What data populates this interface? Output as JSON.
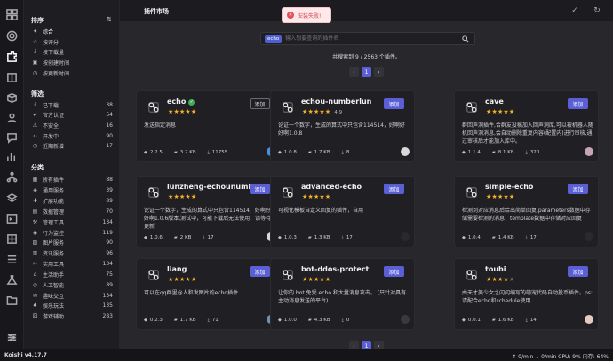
{
  "header": {
    "title": "插件市场"
  },
  "toast": {
    "text": "安装失败!"
  },
  "search": {
    "tag": "echo",
    "placeholder": "输入想要查询的插件名"
  },
  "results": {
    "text": "共搜索到 9 / 2563 个插件。"
  },
  "pagination": {
    "current": "1",
    "prev": "‹",
    "next": "›"
  },
  "sidebar": {
    "sort_title": "排序",
    "sort_items": [
      {
        "label": "综合"
      },
      {
        "label": "按评分"
      },
      {
        "label": "按下载量"
      },
      {
        "label": "按创建时间"
      },
      {
        "label": "按更新时间"
      }
    ],
    "filter_title": "筛选",
    "filter_items": [
      {
        "label": "已下载",
        "count": "38"
      },
      {
        "label": "官方认证",
        "count": "54"
      },
      {
        "label": "不安全",
        "count": "16"
      },
      {
        "label": "开发中",
        "count": "90"
      },
      {
        "label": "近期新增",
        "count": "17"
      }
    ],
    "category_title": "分类",
    "category_items": [
      {
        "label": "所有插件",
        "count": "88"
      },
      {
        "label": "通用服务",
        "count": "39"
      },
      {
        "label": "扩展功能",
        "count": "89"
      },
      {
        "label": "数据管理",
        "count": "70"
      },
      {
        "label": "管理工具",
        "count": "134"
      },
      {
        "label": "行为监控",
        "count": "119"
      },
      {
        "label": "图片服务",
        "count": "90"
      },
      {
        "label": "资讯服务",
        "count": "96"
      },
      {
        "label": "实用工具",
        "count": "134"
      },
      {
        "label": "生活助手",
        "count": "75"
      },
      {
        "label": "人工智能",
        "count": "89"
      },
      {
        "label": "趣味交互",
        "count": "134"
      },
      {
        "label": "娱乐玩法",
        "count": "135"
      },
      {
        "label": "游戏辅助",
        "count": "283"
      }
    ]
  },
  "plugins": [
    {
      "name": "echo",
      "verified": true,
      "stars": 5,
      "rating": "",
      "button": "添加",
      "button_style": "outline",
      "desc": "发送指定消息",
      "version": "2.2.5",
      "size": "3.2 KB",
      "downloads": "11755",
      "avatar_color": "#4b8fd6"
    },
    {
      "name": "echou-numberlun",
      "verified": false,
      "stars": 5,
      "rating": "4.9",
      "button": "添加",
      "button_style": "filled",
      "desc": "论证一个数字，生成的算式中只包含114514，好啊好好啊1.0.8",
      "version": "1.0.8",
      "size": "1.7 KB",
      "downloads": "8",
      "avatar_color": "#d8d8d8"
    },
    {
      "name": "cave",
      "verified": false,
      "stars": 5,
      "rating": "",
      "button": "添加",
      "button_style": "filled",
      "desc": "群回声洞插件,合群友投稿加入回声洞库,可以被机器人随机回声洞消息,会自动删除重复内容(配置内)进行审核,通过审核后才能加入库中。",
      "version": "1.1.4",
      "size": "8.1 KB",
      "downloads": "320",
      "avatar_color": "#c7a3b6"
    },
    {
      "name": "lunzheng-echounumber",
      "verified": false,
      "stars": 5,
      "rating": "",
      "button": "添加",
      "button_style": "filled",
      "desc": "论证一个数字，生成的算式中只包含114514，好啊好好啊1.0.6版本,测试中，可能下载后无法使用，请等待更新",
      "version": "1.0.6",
      "size": "2 KB",
      "downloads": "17",
      "avatar_color": "#d8d8d8"
    },
    {
      "name": "advanced-echo",
      "verified": false,
      "stars": 5,
      "rating": "",
      "button": "添加",
      "button_style": "filled",
      "desc": "可视化模板自定义回复的插件，自用",
      "version": "1.0.3",
      "size": "1.3 KB",
      "downloads": "17",
      "avatar_color": "#2a2a2e"
    },
    {
      "name": "simple-echo",
      "verified": false,
      "stars": 5,
      "rating": "",
      "button": "添加",
      "button_style": "filled",
      "desc": "检测到对应消息后给出简单回复,parameters数据中存储需要检测的消息，template数据中存储对应回复",
      "version": "1.0.4",
      "size": "1.4 KB",
      "downloads": "17",
      "avatar_color": "#2a2a2e"
    },
    {
      "name": "liang",
      "verified": false,
      "stars": 5,
      "rating": "",
      "button": "添加",
      "button_style": "filled",
      "desc": "可以在qq群里@人和发图片的echo插件",
      "version": "0.2.3",
      "size": "1.7 KB",
      "downloads": "71",
      "avatar_color": "#6d8fb0"
    },
    {
      "name": "bot-ddos-protect",
      "verified": false,
      "stars": 5,
      "rating": "",
      "button": "添加",
      "button_style": "filled",
      "desc": "让你的 bot 免受 echo 和大量消息攻击。 (只针对具有主动消息发送的平台)",
      "version": "1.0.0",
      "size": "4.3 KB",
      "downloads": "0",
      "avatar_color": "#3a3a3e"
    },
    {
      "name": "toubi",
      "verified": false,
      "stars": 4,
      "rating": "",
      "button": "添加",
      "button_style": "filled",
      "desc": "由天才美少女之闪闪编写的萌宠代码自动投币插件。ps:请配合echo和schedule使用",
      "version": "0.0.1",
      "size": "1.6 KB",
      "downloads": "14",
      "avatar_color": "#e8c9c0"
    }
  ],
  "statusbar": {
    "version": "Koishi v4.17.7",
    "stats": "↑ 0/min  ↓ 0/min  CPU: 9% 内存: 64%"
  }
}
